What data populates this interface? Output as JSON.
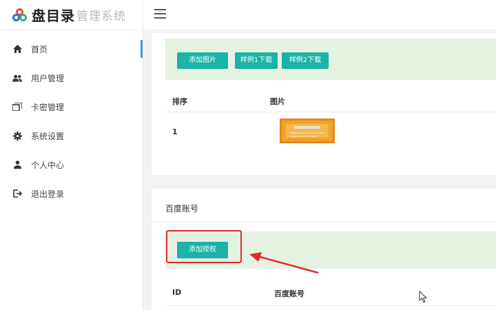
{
  "logo": {
    "strong": "盘目录",
    "light": "管理系统"
  },
  "sidebar": {
    "items": [
      {
        "label": "首页",
        "icon": "home-icon",
        "active": true
      },
      {
        "label": "用户管理",
        "icon": "users-icon"
      },
      {
        "label": "卡密管理",
        "icon": "cards-icon"
      },
      {
        "label": "系统设置",
        "icon": "gear-icon"
      },
      {
        "label": "个人中心",
        "icon": "person-icon"
      },
      {
        "label": "退出登录",
        "icon": "logout-icon"
      }
    ]
  },
  "image_section": {
    "buttons": {
      "add": "添加图片",
      "sample1": "样例1下载",
      "sample2": "样例2下载"
    },
    "columns": {
      "order": "排序",
      "image": "图片"
    },
    "rows": [
      {
        "order": "1"
      }
    ]
  },
  "baidu_section": {
    "title": "百度账号",
    "add_button": "添加授权",
    "columns": {
      "id": "ID",
      "account": "百度账号"
    }
  },
  "colors": {
    "accent": "#1bb2a7",
    "toolbar_bg": "#e5f2e2",
    "highlight": "#e02a2a",
    "active_bar": "#3aa0d8"
  }
}
